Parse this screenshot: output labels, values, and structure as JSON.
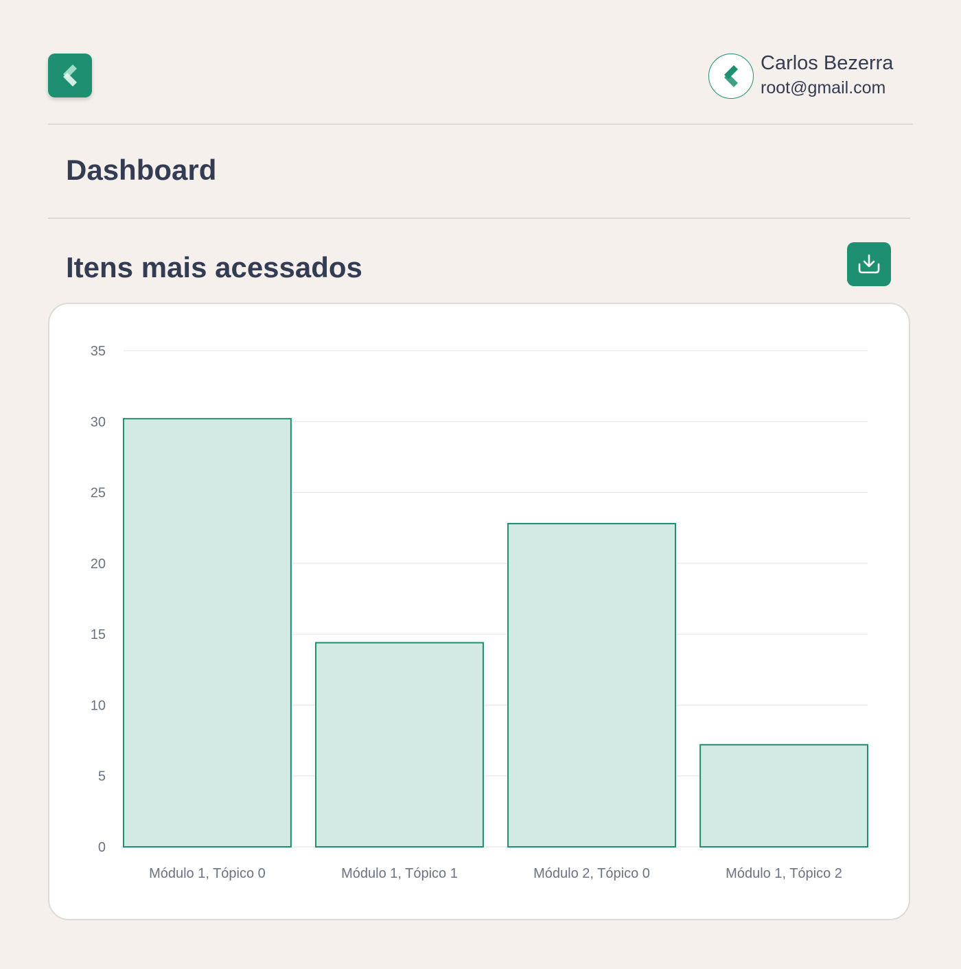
{
  "header": {
    "logo_icon": "brand-logo-icon",
    "user": {
      "name": "Carlos Bezerra",
      "email": "root@gmail.com",
      "avatar_icon": "brand-logo-icon"
    }
  },
  "page": {
    "title": "Dashboard"
  },
  "section": {
    "title": "Itens mais acessados",
    "download_icon": "download-icon"
  },
  "colors": {
    "accent": "#1e8f70",
    "bar_fill": "#d3e9e3",
    "background": "#f5f0eb",
    "text": "#343c54"
  },
  "chart_data": {
    "type": "bar",
    "categories": [
      "Módulo 1, Tópico 0",
      "Módulo 1, Tópico 1",
      "Módulo 2, Tópico 0",
      "Módulo 1, Tópico 2"
    ],
    "values": [
      30.2,
      14.4,
      22.8,
      7.2
    ],
    "ylim": [
      0,
      35
    ],
    "yticks": [
      0,
      5,
      10,
      15,
      20,
      25,
      30,
      35
    ],
    "grid": true,
    "title": "",
    "xlabel": "",
    "ylabel": ""
  }
}
